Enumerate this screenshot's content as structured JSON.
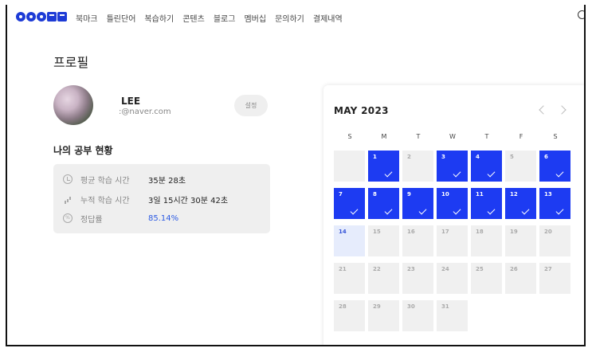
{
  "nav": {
    "menu": [
      "북마크",
      "틀린단어",
      "복습하기",
      "콘텐츠",
      "블로그",
      "멤버십",
      "문의하기",
      "결제내역"
    ]
  },
  "profile": {
    "title": "프로필",
    "name": "LEE",
    "email": ":@naver.com",
    "settings_label": "설정"
  },
  "study": {
    "title": "나의 공부 현황",
    "stats": [
      {
        "icon": "clock-icon",
        "label": "평균 학습 시간",
        "value": "35분 28초"
      },
      {
        "icon": "bar-chart-icon",
        "label": "누적 학습 시간",
        "value": "3일 15시간 30분 42초"
      },
      {
        "icon": "percent-icon",
        "label": "정답률",
        "value": "85.14%"
      }
    ]
  },
  "calendar": {
    "title": "MAY 2023",
    "weekdays": [
      "S",
      "M",
      "T",
      "W",
      "T",
      "F",
      "S"
    ],
    "weeks": [
      [
        "",
        "1",
        "2",
        "3",
        "4",
        "5",
        "6"
      ],
      [
        "7",
        "8",
        "9",
        "10",
        "11",
        "12",
        "13"
      ],
      [
        "14",
        "15",
        "16",
        "17",
        "18",
        "19",
        "20"
      ],
      [
        "21",
        "22",
        "23",
        "24",
        "25",
        "26",
        "27"
      ],
      [
        "28",
        "29",
        "30",
        "31",
        "",
        "",
        ""
      ]
    ],
    "completed_days": [
      "1",
      "3",
      "4",
      "6",
      "7",
      "8",
      "9",
      "10",
      "11",
      "12",
      "13"
    ],
    "today": "14",
    "colors": {
      "completed": "#1d3bf2",
      "today": "#e6ecfc",
      "accent": "#2d5be3"
    }
  }
}
